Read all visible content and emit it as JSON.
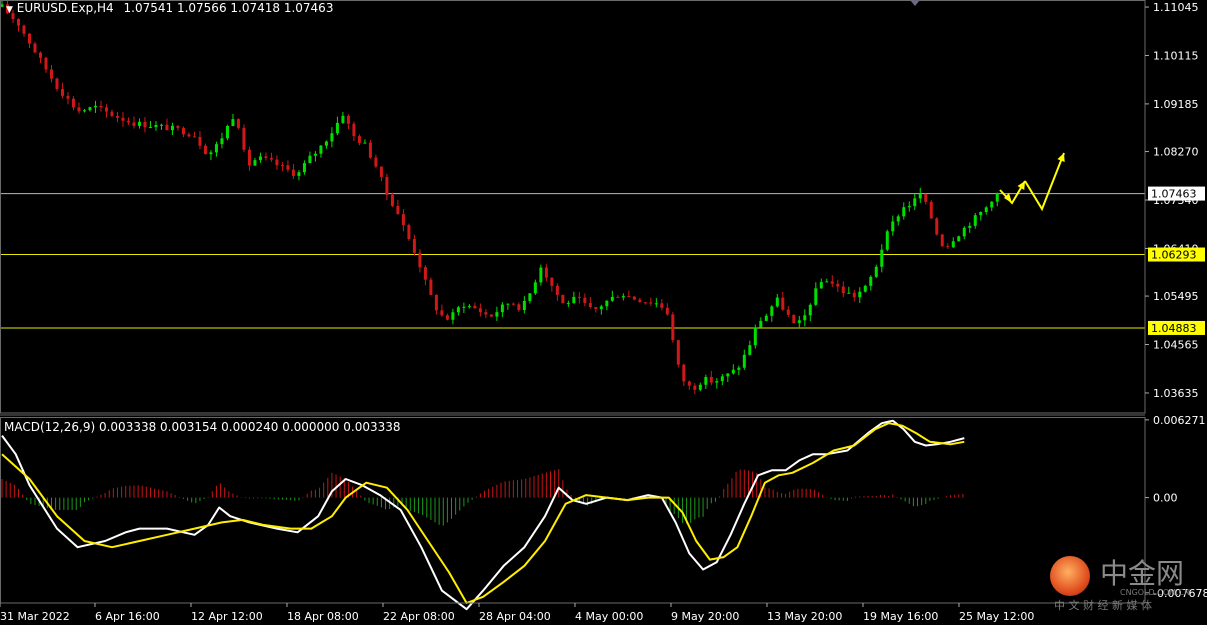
{
  "header": {
    "symbol": "EURUSD.Exp,H4",
    "ohlc": "1.07541 1.07566 1.07418 1.07463"
  },
  "macd_label": {
    "name": "MACD(12,26,9)",
    "values": "0.003338 0.003154 0.000240 0.000000 0.003338"
  },
  "watermark": {
    "brand": "中金网",
    "site": "CNGOLD.COM.CN",
    "tagline": "中 文 财 经 新 媒 体"
  },
  "colors": {
    "bull": "#00e000",
    "bear": "#d01818",
    "level_line": "#e8e800",
    "price_line": "#b8b8b8",
    "macd_main": "#ffffff",
    "macd_signal": "#ffee00",
    "hist_pos": "#c81414",
    "hist_neg": "#1a9a1a",
    "arrows": "#ffff00"
  },
  "chart_data": [
    {
      "type": "candlestick",
      "panel": "price",
      "ylim": [
        1.0325,
        1.1118
      ],
      "y_ticks": [
        "1.11045",
        "1.10115",
        "1.09185",
        "1.08270",
        "1.07340",
        "1.06410",
        "1.05495",
        "1.04565",
        "1.03635"
      ],
      "x_labels": [
        "31 Mar 2022",
        "6 Apr 16:00",
        "12 Apr 12:00",
        "18 Apr 08:00",
        "22 Apr 08:00",
        "28 Apr 04:00",
        "4 May 00:00",
        "9 May 20:00",
        "13 May 20:00",
        "19 May 16:00",
        "25 May 12:00"
      ],
      "close_path": [
        [
          0,
          1.1105
        ],
        [
          12,
          1.1072
        ],
        [
          25,
          1.1015
        ],
        [
          40,
          1.0952
        ],
        [
          55,
          1.0905
        ],
        [
          68,
          1.0912
        ],
        [
          80,
          1.0898
        ],
        [
          95,
          1.0882
        ],
        [
          115,
          1.0875
        ],
        [
          130,
          1.0868
        ],
        [
          140,
          1.0858
        ],
        [
          150,
          1.082
        ],
        [
          158,
          1.0845
        ],
        [
          170,
          1.0905
        ],
        [
          178,
          1.0798
        ],
        [
          186,
          1.0815
        ],
        [
          195,
          1.0808
        ],
        [
          205,
          1.0795
        ],
        [
          215,
          1.0782
        ],
        [
          222,
          1.081
        ],
        [
          230,
          1.083
        ],
        [
          240,
          1.0865
        ],
        [
          248,
          1.09
        ],
        [
          256,
          1.0856
        ],
        [
          264,
          1.084
        ],
        [
          272,
          1.08
        ],
        [
          280,
          1.0745
        ],
        [
          287,
          1.0715
        ],
        [
          295,
          1.0665
        ],
        [
          302,
          1.0625
        ],
        [
          310,
          1.056
        ],
        [
          318,
          1.0515
        ],
        [
          325,
          1.0505
        ],
        [
          335,
          1.0535
        ],
        [
          345,
          1.0525
        ],
        [
          355,
          1.051
        ],
        [
          362,
          1.0525
        ],
        [
          370,
          1.054
        ],
        [
          378,
          1.0525
        ],
        [
          385,
          1.056
        ],
        [
          392,
          1.0608
        ],
        [
          400,
          1.057
        ],
        [
          408,
          1.0535
        ],
        [
          418,
          1.0545
        ],
        [
          430,
          1.052
        ],
        [
          440,
          1.054
        ],
        [
          450,
          1.0555
        ],
        [
          460,
          1.0545
        ],
        [
          468,
          1.054
        ],
        [
          478,
          1.0535
        ],
        [
          485,
          1.0515
        ],
        [
          490,
          1.043
        ],
        [
          495,
          1.039
        ],
        [
          502,
          1.037
        ],
        [
          510,
          1.039
        ],
        [
          518,
          1.0385
        ],
        [
          526,
          1.0395
        ],
        [
          535,
          1.041
        ],
        [
          543,
          1.045
        ],
        [
          550,
          1.05
        ],
        [
          557,
          1.0515
        ],
        [
          563,
          1.0545
        ],
        [
          570,
          1.052
        ],
        [
          577,
          1.049
        ],
        [
          583,
          1.0505
        ],
        [
          590,
          1.055
        ],
        [
          598,
          1.0585
        ],
        [
          605,
          1.0572
        ],
        [
          612,
          1.0558
        ],
        [
          620,
          1.055
        ],
        [
          628,
          1.0565
        ],
        [
          635,
          1.06
        ],
        [
          642,
          1.0658
        ],
        [
          650,
          1.07
        ],
        [
          656,
          1.072
        ],
        [
          662,
          1.0728
        ],
        [
          668,
          1.0745
        ],
        [
          674,
          1.0715
        ],
        [
          680,
          1.067
        ],
        [
          686,
          1.064
        ],
        [
          692,
          1.066
        ],
        [
          700,
          1.068
        ],
        [
          708,
          1.07
        ],
        [
          716,
          1.072
        ],
        [
          722,
          1.0745
        ],
        [
          726,
          1.0746
        ]
      ]
    },
    {
      "type": "macd",
      "panel": "indicator",
      "params": "12,26,9",
      "ylim": [
        -0.0085,
        0.0065
      ],
      "y_ticks": [
        "0.006271",
        "0.00",
        "-0.007678"
      ],
      "main": [
        [
          0,
          0.005
        ],
        [
          10,
          0.0035
        ],
        [
          20,
          0.001
        ],
        [
          40,
          -0.0025
        ],
        [
          55,
          -0.004
        ],
        [
          75,
          -0.0035
        ],
        [
          90,
          -0.0028
        ],
        [
          100,
          -0.0025
        ],
        [
          120,
          -0.0025
        ],
        [
          140,
          -0.003
        ],
        [
          150,
          -0.0022
        ],
        [
          158,
          -0.0008
        ],
        [
          166,
          -0.0015
        ],
        [
          180,
          -0.002
        ],
        [
          200,
          -0.0025
        ],
        [
          215,
          -0.0028
        ],
        [
          230,
          -0.0015
        ],
        [
          240,
          0.0005
        ],
        [
          250,
          0.0015
        ],
        [
          262,
          0.001
        ],
        [
          275,
          0.0002
        ],
        [
          290,
          -0.001
        ],
        [
          305,
          -0.004
        ],
        [
          320,
          -0.0075
        ],
        [
          338,
          -0.009
        ],
        [
          350,
          -0.0075
        ],
        [
          365,
          -0.0055
        ],
        [
          380,
          -0.004
        ],
        [
          395,
          -0.0015
        ],
        [
          405,
          0.0008
        ],
        [
          415,
          -0.0002
        ],
        [
          425,
          -0.0005
        ],
        [
          440,
          0.0
        ],
        [
          455,
          -0.0002
        ],
        [
          470,
          0.0002
        ],
        [
          480,
          0.0
        ],
        [
          490,
          -0.002
        ],
        [
          500,
          -0.0045
        ],
        [
          510,
          -0.0058
        ],
        [
          520,
          -0.0052
        ],
        [
          530,
          -0.003
        ],
        [
          540,
          -0.0005
        ],
        [
          550,
          0.0018
        ],
        [
          560,
          0.0022
        ],
        [
          570,
          0.0022
        ],
        [
          580,
          0.003
        ],
        [
          590,
          0.0035
        ],
        [
          600,
          0.0035
        ],
        [
          615,
          0.0038
        ],
        [
          630,
          0.0052
        ],
        [
          640,
          0.006
        ],
        [
          648,
          0.0062
        ],
        [
          656,
          0.0055
        ],
        [
          664,
          0.0045
        ],
        [
          672,
          0.0042
        ],
        [
          680,
          0.0043
        ],
        [
          690,
          0.0045
        ],
        [
          700,
          0.0048
        ]
      ],
      "signal": [
        [
          0,
          0.0035
        ],
        [
          20,
          0.0015
        ],
        [
          40,
          -0.0015
        ],
        [
          60,
          -0.0035
        ],
        [
          80,
          -0.004
        ],
        [
          100,
          -0.0035
        ],
        [
          120,
          -0.003
        ],
        [
          140,
          -0.0025
        ],
        [
          160,
          -0.002
        ],
        [
          175,
          -0.0018
        ],
        [
          190,
          -0.0022
        ],
        [
          210,
          -0.0025
        ],
        [
          225,
          -0.0025
        ],
        [
          240,
          -0.0015
        ],
        [
          250,
          0.0
        ],
        [
          265,
          0.0012
        ],
        [
          280,
          0.0008
        ],
        [
          295,
          -0.001
        ],
        [
          310,
          -0.0035
        ],
        [
          325,
          -0.006
        ],
        [
          338,
          -0.0085
        ],
        [
          350,
          -0.008
        ],
        [
          365,
          -0.0068
        ],
        [
          380,
          -0.0055
        ],
        [
          395,
          -0.0035
        ],
        [
          410,
          -0.0005
        ],
        [
          425,
          0.0002
        ],
        [
          440,
          0.0
        ],
        [
          455,
          -0.0002
        ],
        [
          470,
          0.0
        ],
        [
          485,
          0.0
        ],
        [
          495,
          -0.0012
        ],
        [
          505,
          -0.0035
        ],
        [
          515,
          -0.005
        ],
        [
          525,
          -0.0048
        ],
        [
          535,
          -0.004
        ],
        [
          545,
          -0.0015
        ],
        [
          555,
          0.0012
        ],
        [
          565,
          0.0018
        ],
        [
          575,
          0.002
        ],
        [
          590,
          0.0028
        ],
        [
          605,
          0.0038
        ],
        [
          620,
          0.0042
        ],
        [
          635,
          0.0055
        ],
        [
          645,
          0.006
        ],
        [
          655,
          0.0058
        ],
        [
          665,
          0.0052
        ],
        [
          675,
          0.0045
        ],
        [
          690,
          0.0043
        ],
        [
          700,
          0.0045
        ]
      ]
    }
  ]
}
